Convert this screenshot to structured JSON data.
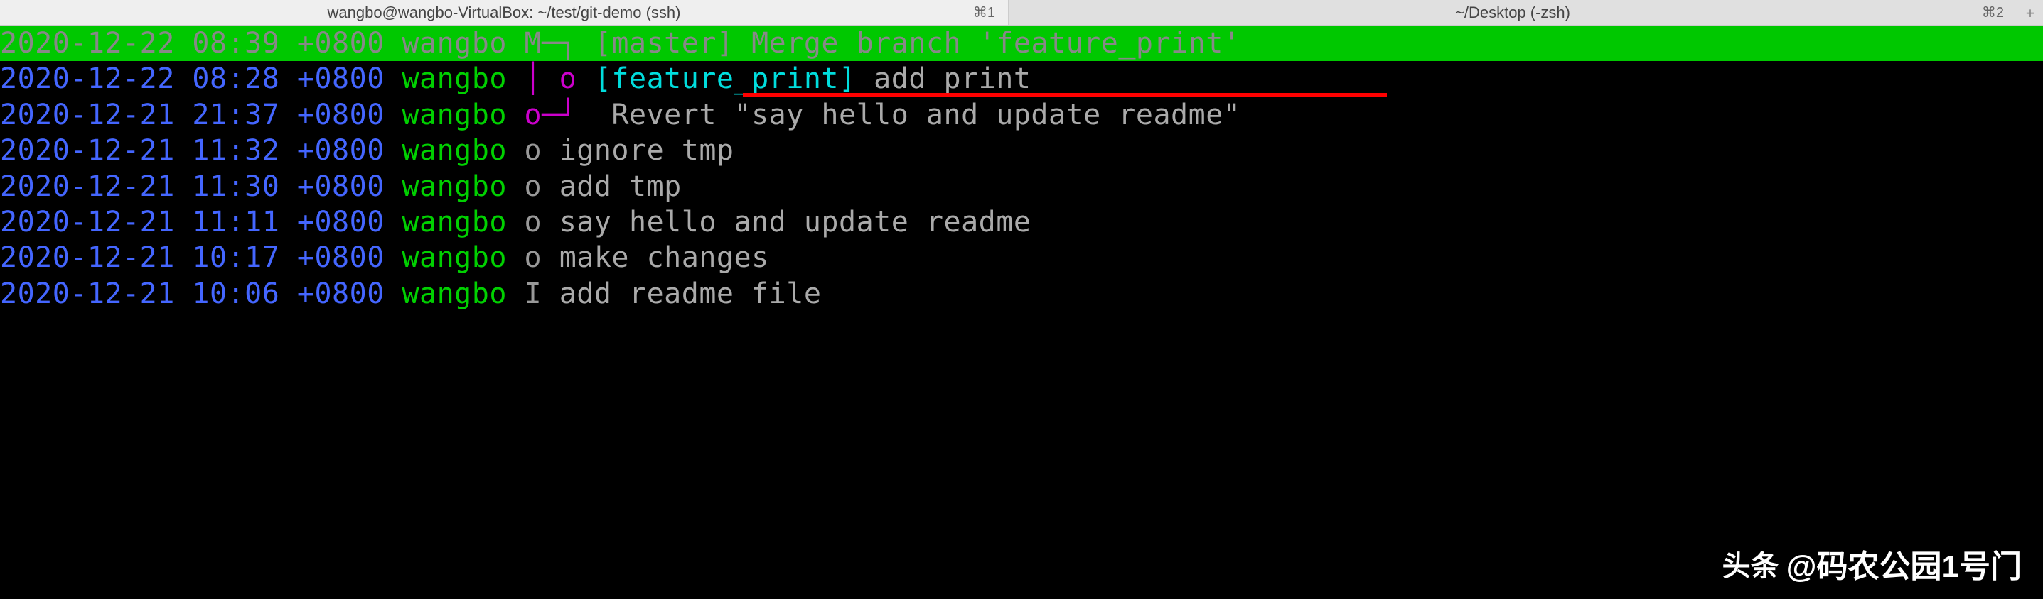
{
  "tabs": [
    {
      "title": "wangbo@wangbo-VirtualBox: ~/test/git-demo (ssh)",
      "shortcut": "⌘1",
      "active": true
    },
    {
      "title": "~/Desktop (-zsh)",
      "shortcut": "⌘2",
      "active": false
    }
  ],
  "log": [
    {
      "date": "2020-12-22 08:39 +0800",
      "author": "wangbo",
      "graph": "M─┐",
      "branch": "[master]",
      "branch_class": "branch-master",
      "message": "Merge branch 'feature_print'",
      "highlighted": true,
      "pad": " "
    },
    {
      "date": "2020-12-22 08:28 +0800",
      "author": "wangbo",
      "graph": "│ o",
      "branch": "[feature_print]",
      "branch_class": "branch-feature",
      "message": "add print",
      "highlighted": false,
      "underline": true,
      "pad": " "
    },
    {
      "date": "2020-12-21 21:37 +0800",
      "author": "wangbo",
      "graph": "o─┘",
      "branch": "",
      "branch_class": "",
      "message": " Revert \"say hello and update readme\"",
      "highlighted": false,
      "pad": " "
    },
    {
      "date": "2020-12-21 11:32 +0800",
      "author": "wangbo",
      "graph": "o",
      "branch": "",
      "branch_class": "",
      "message": "ignore tmp",
      "highlighted": false,
      "pad": " "
    },
    {
      "date": "2020-12-21 11:30 +0800",
      "author": "wangbo",
      "graph": "o",
      "branch": "",
      "branch_class": "",
      "message": "add tmp",
      "highlighted": false,
      "pad": " "
    },
    {
      "date": "2020-12-21 11:11 +0800",
      "author": "wangbo",
      "graph": "o",
      "branch": "",
      "branch_class": "",
      "message": "say hello and update readme",
      "highlighted": false,
      "pad": " "
    },
    {
      "date": "2020-12-21 10:17 +0800",
      "author": "wangbo",
      "graph": "o",
      "branch": "",
      "branch_class": "",
      "message": "make changes",
      "highlighted": false,
      "pad": " "
    },
    {
      "date": "2020-12-21 10:06 +0800",
      "author": "wangbo",
      "graph": "I",
      "branch": "",
      "branch_class": "",
      "message": "add readme file",
      "highlighted": false,
      "pad": " "
    }
  ],
  "watermark": {
    "logo": "头条",
    "text": "@码农公园1号门"
  }
}
